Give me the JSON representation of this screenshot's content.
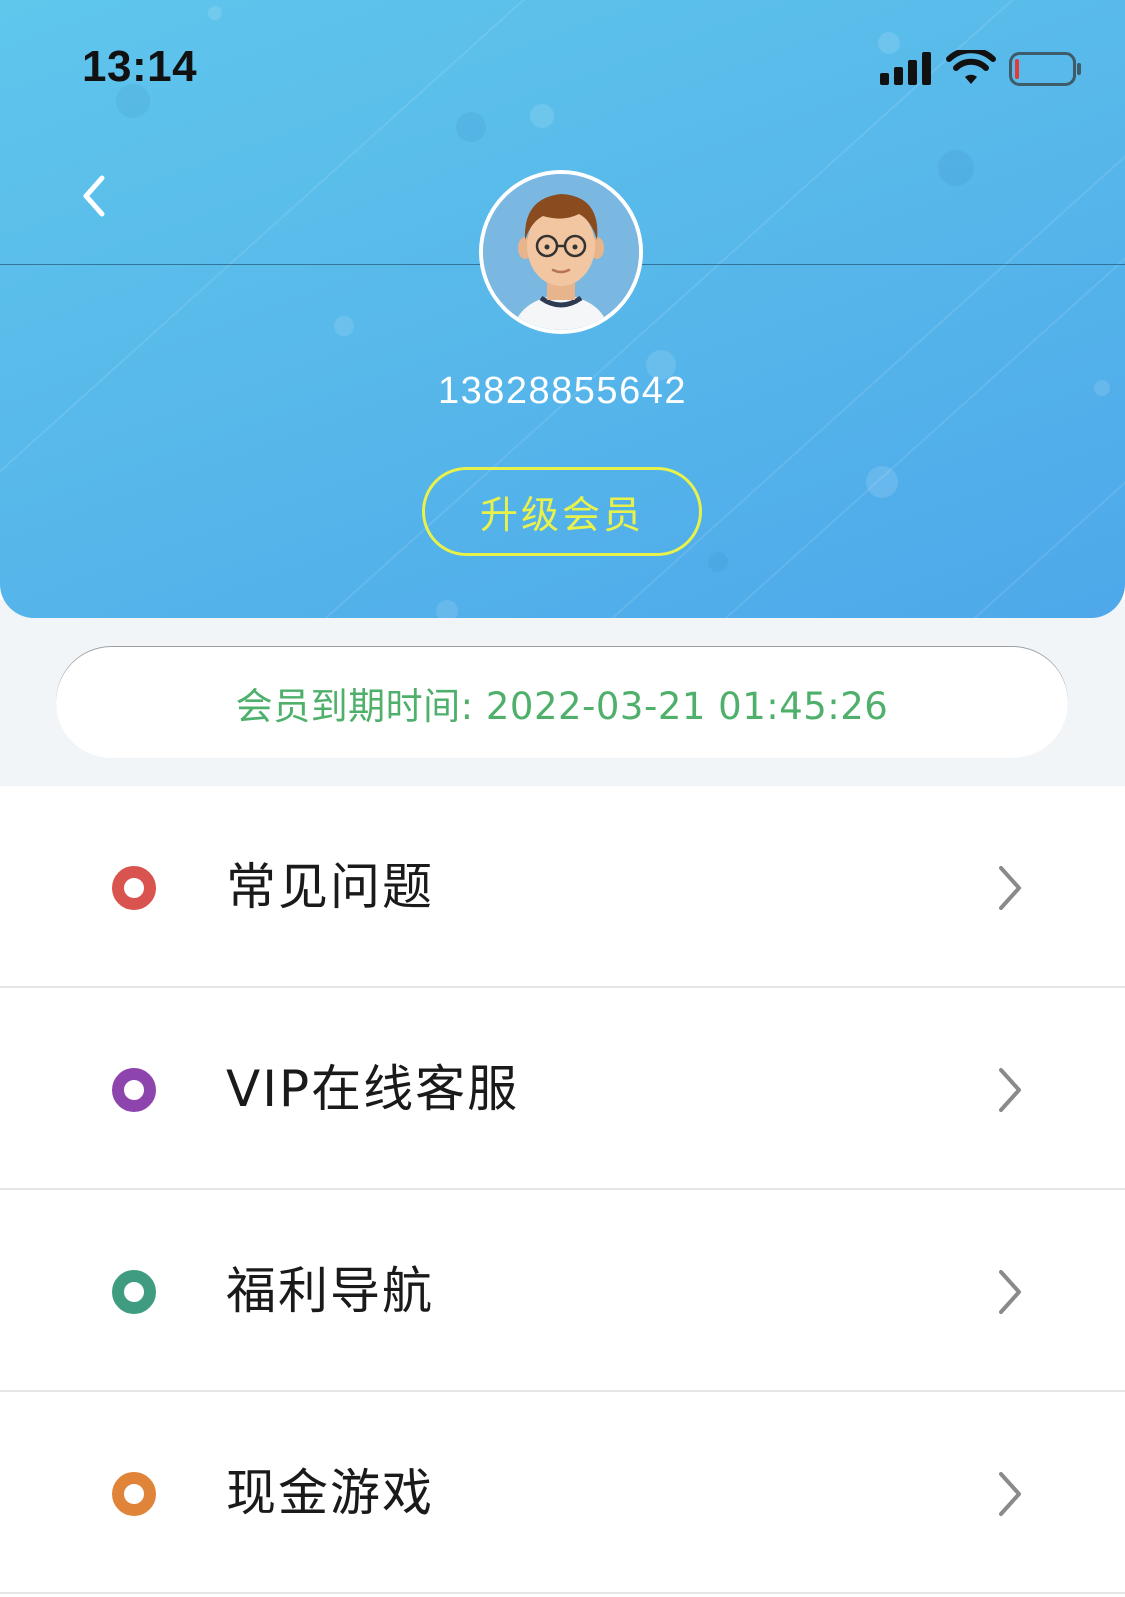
{
  "status_bar": {
    "time": "13:14",
    "icons": [
      "signal-icon",
      "wifi-icon",
      "battery-icon"
    ]
  },
  "header": {
    "back_icon": "chevron-left-icon",
    "avatar": "user-avatar",
    "phone": "13828855642",
    "upgrade_label": "升级会员",
    "colors": {
      "gradient_start": "#5fc6ec",
      "gradient_end": "#4ea8ea",
      "upgrade_accent": "#e9f24a"
    }
  },
  "membership": {
    "expiry_text": "会员到期时间: 2022-03-21 01:45:26",
    "color": "#4fb06b"
  },
  "menu": {
    "items": [
      {
        "label": "常见问题",
        "icon": "ring-icon",
        "color": "#d9534f"
      },
      {
        "label": "VIP在线客服",
        "icon": "ring-icon",
        "color": "#8e44ad"
      },
      {
        "label": "福利导航",
        "icon": "ring-icon",
        "color": "#3f9c80"
      },
      {
        "label": "现金游戏",
        "icon": "ring-icon",
        "color": "#e0843a"
      }
    ],
    "chevron_icon": "chevron-right-icon"
  }
}
